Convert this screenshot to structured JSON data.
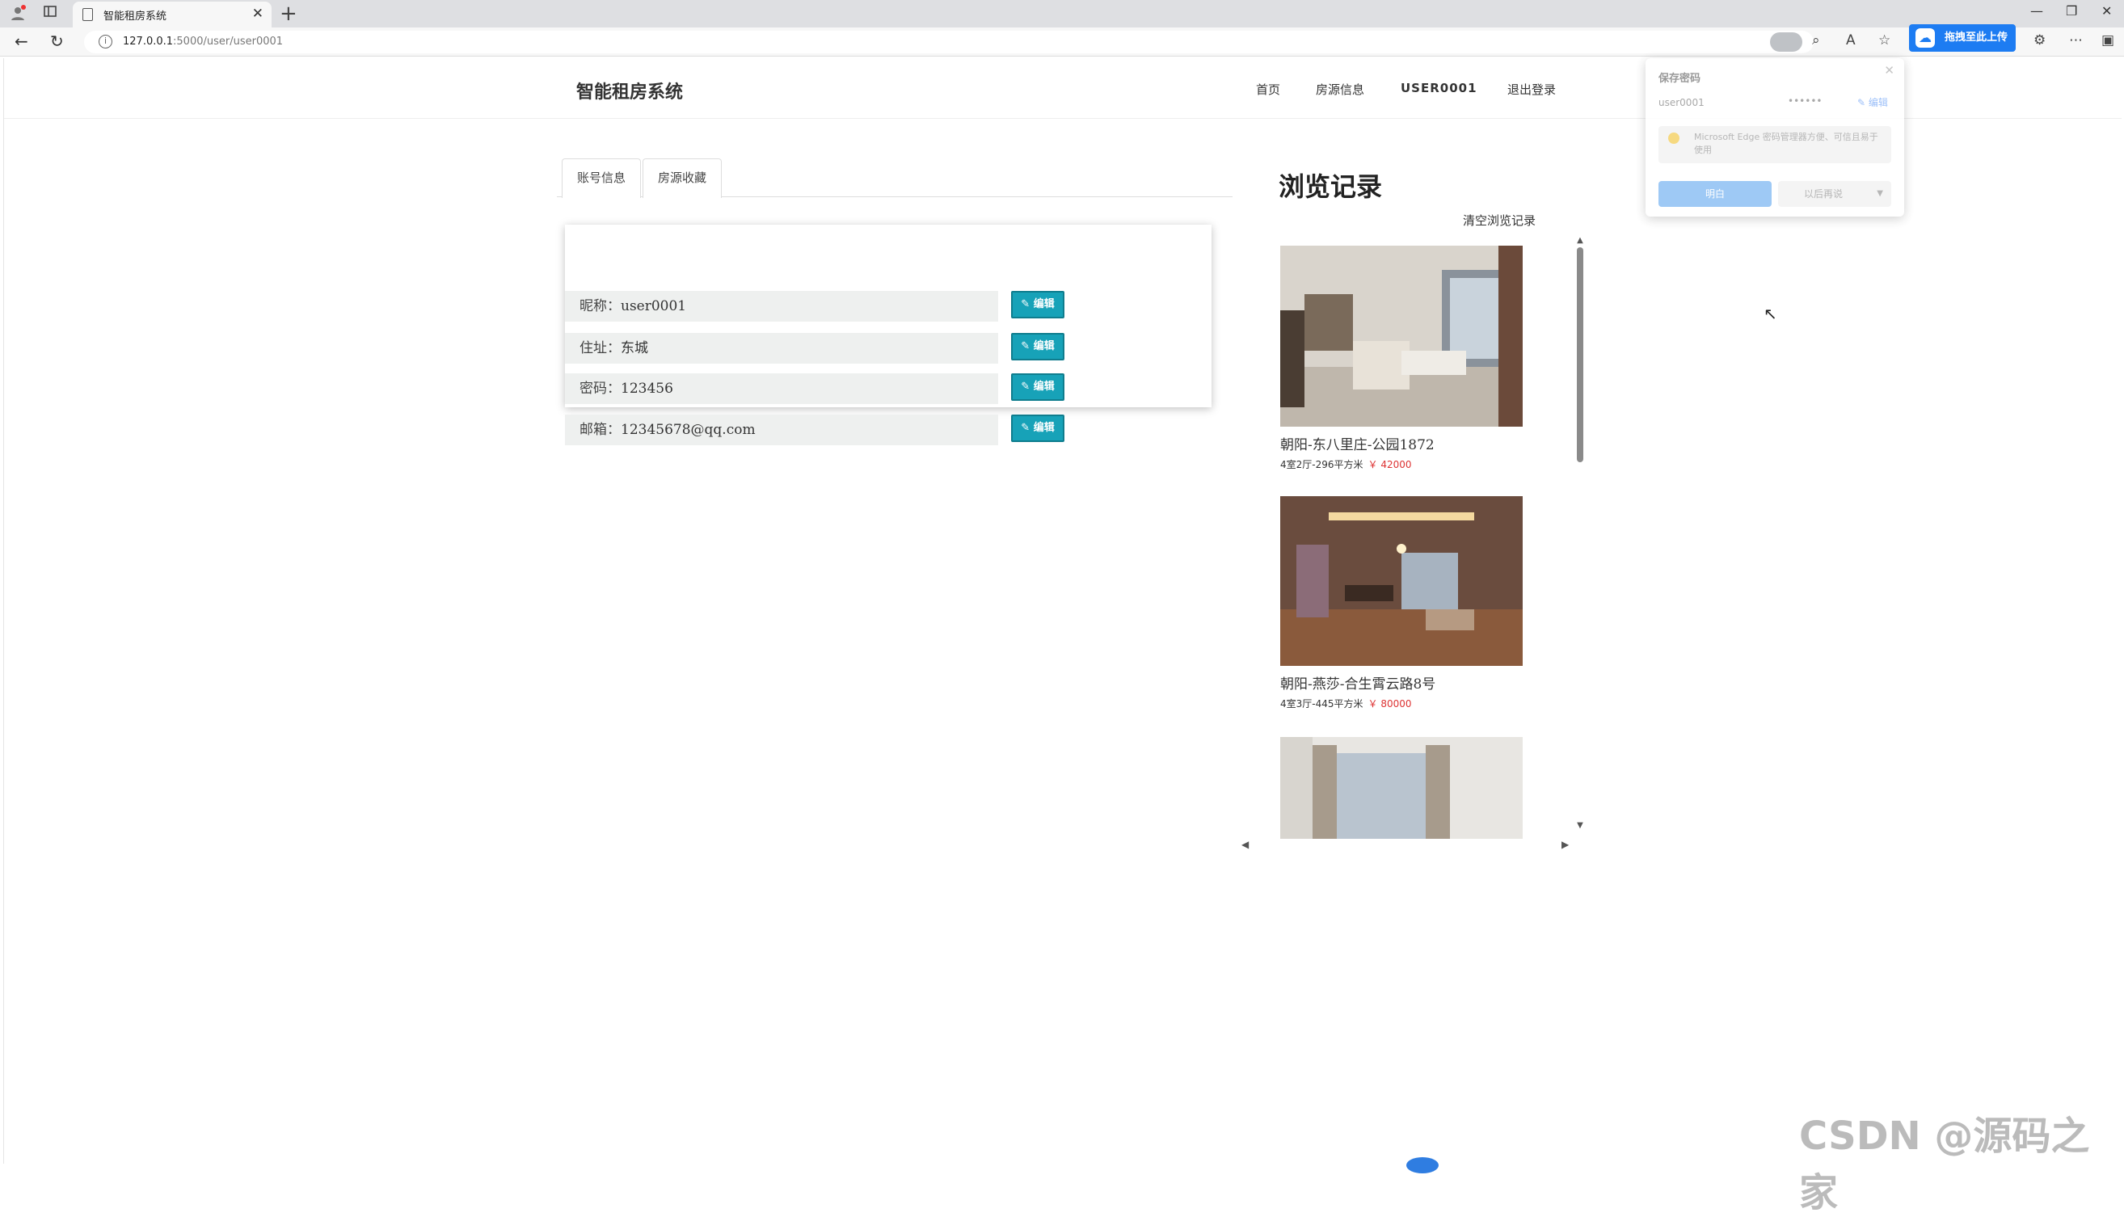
{
  "browser": {
    "tab_title": "智能租房系统",
    "url_host": "127.0.0.1",
    "url_rest": ":5000/user/user0001",
    "upload_label": "拖拽至此上传"
  },
  "header": {
    "brand": "智能租房系统",
    "nav": [
      "首页",
      "房源信息",
      "USER0001",
      "退出登录"
    ]
  },
  "tabs": [
    "账号信息",
    "房源收藏"
  ],
  "account": {
    "fields": [
      {
        "label": "昵称：",
        "value": "user0001"
      },
      {
        "label": "住址：",
        "value": "东城"
      },
      {
        "label": "密码：",
        "value": "123456"
      },
      {
        "label": "邮箱：",
        "value": "12345678@qq.com"
      }
    ],
    "edit_label": "编辑"
  },
  "history": {
    "title": "浏览记录",
    "clear_label": "清空浏览记录",
    "items": [
      {
        "name": "朝阳-东八里庄-公园1872",
        "meta": "4室2厅-296平方米",
        "price": "￥ 42000"
      },
      {
        "name": "朝阳-燕莎-合生霄云路8号",
        "meta": "4室3厅-445平方米",
        "price": "￥ 80000"
      },
      {
        "name": "",
        "meta": "",
        "price": ""
      }
    ]
  },
  "password_popup": {
    "title": "保存密码",
    "username": "user0001",
    "password_mask": "••••••",
    "edit": "编辑",
    "info": "Microsoft Edge 密码管理器方便、可信且易于使用",
    "primary": "明白",
    "secondary": "以后再说"
  },
  "watermark": "CSDN @源码之家"
}
